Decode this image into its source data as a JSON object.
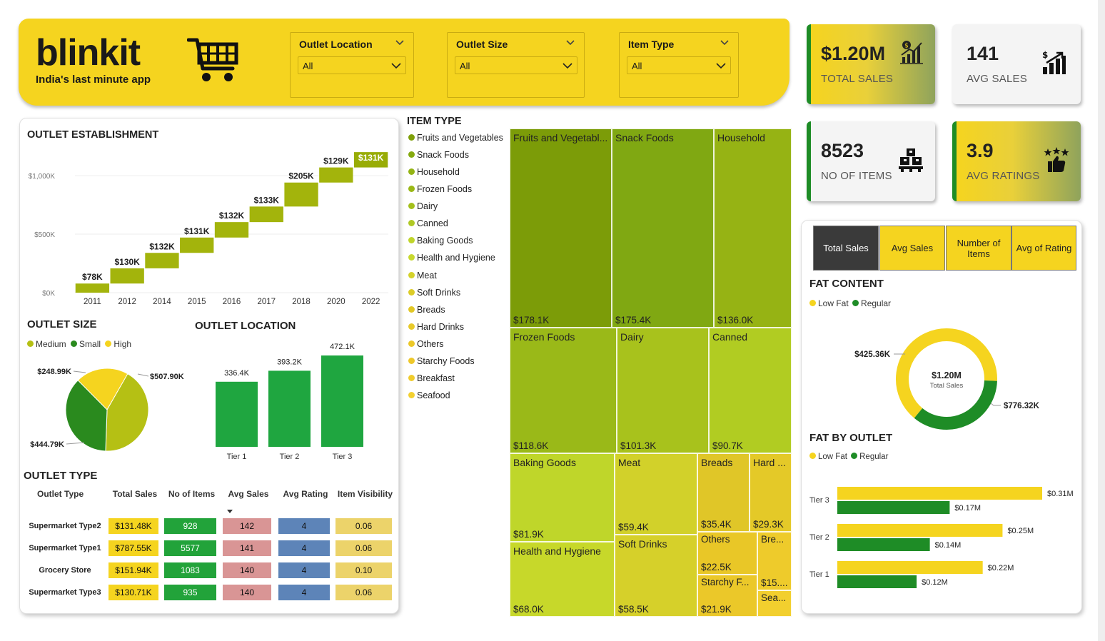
{
  "header": {
    "logo": "blinkit",
    "tagline": "India's last minute app",
    "slicers": [
      {
        "title": "Outlet Location",
        "value": "All"
      },
      {
        "title": "Outlet Size",
        "value": "All"
      },
      {
        "title": "Item Type",
        "value": "All"
      }
    ]
  },
  "kpis": [
    {
      "value": "$1.20M",
      "label": "TOTAL SALES",
      "icon": "sales-chart-icon"
    },
    {
      "value": "141",
      "label": "AVG SALES",
      "icon": "dollar-growth-icon"
    },
    {
      "value": "8523",
      "label": "NO OF ITEMS",
      "icon": "boxes-icon"
    },
    {
      "value": "3.9",
      "label": "AVG RATINGS",
      "icon": "thumbs-stars-icon"
    }
  ],
  "colors": {
    "brand_yellow": "#f5d41f",
    "olive": "#a3b40c",
    "green": "#1fa640",
    "dark_green": "#1e8c26",
    "table_yellow": "#f5d41f",
    "table_green": "#22a33a",
    "table_pink": "#d99595",
    "table_blue": "#5d84b8",
    "table_khaki": "#ecd36a"
  },
  "sections": {
    "outlet_establishment": "OUTLET ESTABLISHMENT",
    "outlet_size": "OUTLET SIZE",
    "outlet_location": "OUTLET LOCATION",
    "outlet_type": "OUTLET TYPE",
    "item_type": "ITEM TYPE",
    "fat_content": "FAT CONTENT",
    "fat_by_outlet": "FAT BY OUTLET"
  },
  "tabs": [
    {
      "label": "Total Sales",
      "active": true
    },
    {
      "label": "Avg Sales",
      "active": false
    },
    {
      "label": "Number of Items",
      "active": false
    },
    {
      "label": "Avg of Rating",
      "active": false
    }
  ],
  "outlet_type_table": {
    "headers": [
      "Outlet Type",
      "Total Sales",
      "No of Items",
      "Avg Sales",
      "Avg Rating",
      "Item Visibility"
    ],
    "rows": [
      {
        "type": "Supermarket Type2",
        "sales": "$131.48K",
        "items": "928",
        "avg": "142",
        "rating": "4",
        "vis": "0.06"
      },
      {
        "type": "Supermarket Type1",
        "sales": "$787.55K",
        "items": "5577",
        "avg": "141",
        "rating": "4",
        "vis": "0.06"
      },
      {
        "type": "Grocery Store",
        "sales": "$151.94K",
        "items": "1083",
        "avg": "140",
        "rating": "4",
        "vis": "0.10"
      },
      {
        "type": "Supermarket Type3",
        "sales": "$130.71K",
        "items": "935",
        "avg": "140",
        "rating": "4",
        "vis": "0.06"
      }
    ]
  },
  "chart_data": [
    {
      "id": "outlet_establishment",
      "type": "bar",
      "subtype": "waterfall",
      "title": "OUTLET ESTABLISHMENT",
      "categories": [
        "2011",
        "2012",
        "2014",
        "2015",
        "2016",
        "2017",
        "2018",
        "2020",
        "2022"
      ],
      "values": [
        78,
        130,
        132,
        131,
        132,
        133,
        205,
        129,
        131
      ],
      "value_labels": [
        "$78K",
        "$130K",
        "$132K",
        "$131K",
        "$132K",
        "$133K",
        "$205K",
        "$129K",
        "$131K"
      ],
      "y_ticks": [
        "$0K",
        "$500K",
        "$1,000K"
      ],
      "ylim": [
        0,
        1220
      ],
      "unit": "K",
      "bar_colors": [
        "#a3b40c",
        "#a3b40c",
        "#a3b40c",
        "#a3b40c",
        "#a3b40c",
        "#a3b40c",
        "#a3b40c",
        "#a3b40c",
        "#98ac06"
      ]
    },
    {
      "id": "outlet_size",
      "type": "pie",
      "title": "OUTLET SIZE",
      "legend": [
        "Medium",
        "Small",
        "High"
      ],
      "series": [
        {
          "name": "Medium",
          "value": 507.9,
          "label": "$507.90K",
          "color": "#b5c014"
        },
        {
          "name": "Small",
          "value": 444.79,
          "label": "$444.79K",
          "color": "#2a8a1e"
        },
        {
          "name": "High",
          "value": 248.99,
          "label": "$248.99K",
          "color": "#f5d41f"
        }
      ]
    },
    {
      "id": "outlet_location",
      "type": "bar",
      "title": "OUTLET LOCATION",
      "categories": [
        "Tier 1",
        "Tier 2",
        "Tier 3"
      ],
      "values": [
        336.4,
        393.2,
        472.1
      ],
      "value_labels": [
        "336.4K",
        "393.2K",
        "472.1K"
      ],
      "ylim": [
        0,
        472.1
      ],
      "color": "#1fa640"
    },
    {
      "id": "item_type",
      "type": "heatmap",
      "subtype": "treemap",
      "title": "ITEM TYPE",
      "legend": [
        "Fruits and Vegetables",
        "Snack Foods",
        "Household",
        "Frozen Foods",
        "Dairy",
        "Canned",
        "Baking Goods",
        "Health and Hygiene",
        "Meat",
        "Soft Drinks",
        "Breads",
        "Hard Drinks",
        "Others",
        "Starchy Foods",
        "Breakfast",
        "Seafood"
      ],
      "legend_colors": [
        "#7fa00a",
        "#85aa10",
        "#94b414",
        "#9ab816",
        "#a4c01b",
        "#b0c925",
        "#c0d52b",
        "#c8d92f",
        "#d4d22a",
        "#dccc27",
        "#e2c826",
        "#e8ca2a",
        "#ecc828",
        "#eec82a",
        "#f0cc2c",
        "#f3d030"
      ],
      "tiles": [
        {
          "name": "Fruits and Vegetabl...",
          "value_label": "$178.1K",
          "color": "#7c9c08"
        },
        {
          "name": "Snack Foods",
          "value_label": "$175.4K",
          "color": "#80a812"
        },
        {
          "name": "Household",
          "value_label": "$136.0K",
          "color": "#96b314"
        },
        {
          "name": "Frozen Foods",
          "value_label": "$118.6K",
          "color": "#9ab918"
        },
        {
          "name": "Dairy",
          "value_label": "$101.3K",
          "color": "#a8c21c"
        },
        {
          "name": "Canned",
          "value_label": "$90.7K",
          "color": "#b1cc22"
        },
        {
          "name": "Baking Goods",
          "value_label": "$81.9K",
          "color": "#bfd62a"
        },
        {
          "name": "Health and Hygiene",
          "value_label": "$68.0K",
          "color": "#c7d82a"
        },
        {
          "name": "Meat",
          "value_label": "$59.4K",
          "color": "#d2d12a"
        },
        {
          "name": "Soft Drinks",
          "value_label": "$58.5K",
          "color": "#d6d02a"
        },
        {
          "name": "Breads",
          "value_label": "$35.4K",
          "color": "#e0c628"
        },
        {
          "name": "Hard ...",
          "value_label": "$29.3K",
          "color": "#e4c928"
        },
        {
          "name": "Others",
          "value_label": "$22.5K",
          "color": "#e9c727"
        },
        {
          "name": "Bre...",
          "value_label": "$15....",
          "color": "#eecb2b"
        },
        {
          "name": "Starchy F...",
          "value_label": "$21.9K",
          "color": "#ebc829"
        },
        {
          "name": "Sea...",
          "value_label": "",
          "color": "#f2cf2e"
        }
      ]
    },
    {
      "id": "fat_content",
      "type": "pie",
      "subtype": "donut",
      "title": "FAT CONTENT",
      "legend": [
        "Low Fat",
        "Regular"
      ],
      "center_value": "$1.20M",
      "center_label": "Total Sales",
      "series": [
        {
          "name": "Low Fat",
          "value": 776.32,
          "label": "$776.32K",
          "color": "#f5d41f"
        },
        {
          "name": "Regular",
          "value": 425.36,
          "label": "$425.36K",
          "color": "#1e8c26"
        }
      ]
    },
    {
      "id": "fat_by_outlet",
      "type": "bar",
      "orientation": "horizontal",
      "title": "FAT BY OUTLET",
      "legend": [
        "Low Fat",
        "Regular"
      ],
      "categories": [
        "Tier 3",
        "Tier 2",
        "Tier 1"
      ],
      "series": [
        {
          "name": "Low Fat",
          "values": [
            0.31,
            0.25,
            0.22
          ],
          "labels": [
            "$0.31M",
            "$0.25M",
            "$0.22M"
          ],
          "color": "#f5d41f"
        },
        {
          "name": "Regular",
          "values": [
            0.17,
            0.14,
            0.12
          ],
          "labels": [
            "$0.17M",
            "$0.14M",
            "$0.12M"
          ],
          "color": "#1e8c26"
        }
      ],
      "xlim": [
        0,
        0.31
      ]
    }
  ]
}
